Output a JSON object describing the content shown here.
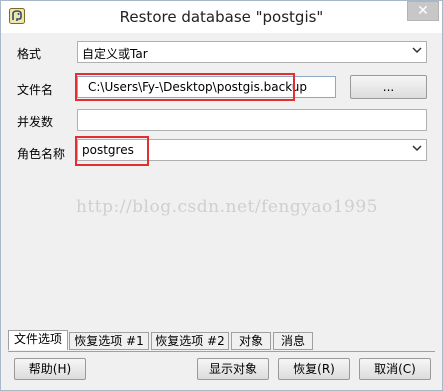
{
  "window": {
    "title": "Restore database \"postgis\"",
    "close_glyph": "✕"
  },
  "form": {
    "format_label": "格式",
    "format_value": "自定义或Tar",
    "filename_label": "文件名",
    "filename_value": "C:\\Users\\Fy-\\Desktop\\postgis.backup",
    "browse_label": "...",
    "jobs_label": "并发数",
    "jobs_value": "",
    "role_label": "角色名称",
    "role_value": "postgres"
  },
  "watermark": "http://blog.csdn.net/fengyao1995",
  "tabs": [
    {
      "label": "文件选项"
    },
    {
      "label": "恢复选项 #1"
    },
    {
      "label": "恢复选项 #2"
    },
    {
      "label": "对象"
    },
    {
      "label": "消息"
    }
  ],
  "buttons": {
    "help": "帮助(H)",
    "show_objects": "显示对象",
    "restore": "恢复(R)",
    "cancel": "取消(C)"
  },
  "colors": {
    "highlight": "#e03030",
    "accent": "#8fa8c8"
  }
}
